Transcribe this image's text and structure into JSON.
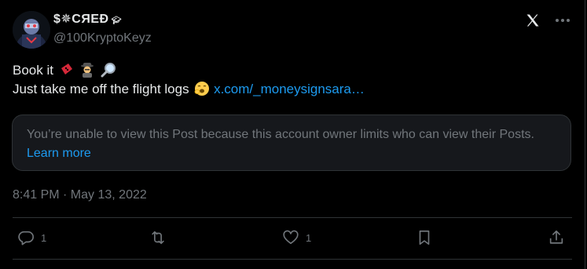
{
  "post": {
    "author": {
      "display_name": "$✵CЯEÐ",
      "name_icon": "graduation-cap-icon",
      "handle": "@100KryptoKeyz"
    },
    "text": {
      "line1": "Book it",
      "line1_emojis": [
        "ticket-icon",
        "detective-icon",
        "magnifying-glass-icon"
      ],
      "line2": "Just take me off the flight logs",
      "line2_emoji": "yawning-face-icon",
      "link": "x.com/_moneysignsara…"
    },
    "quoted_notice": {
      "message": "You’re unable to view this Post because this account owner limits who can view their Posts.",
      "learn_more": "Learn more"
    },
    "timestamp": "8:41 PM · May 13, 2022",
    "actions": {
      "replies": "1",
      "reposts": "",
      "likes": "1"
    }
  },
  "colors": {
    "background": "#000000",
    "text": "#e7e9ea",
    "muted": "#71767b",
    "link": "#1d9bf0",
    "border": "#2f3336"
  }
}
